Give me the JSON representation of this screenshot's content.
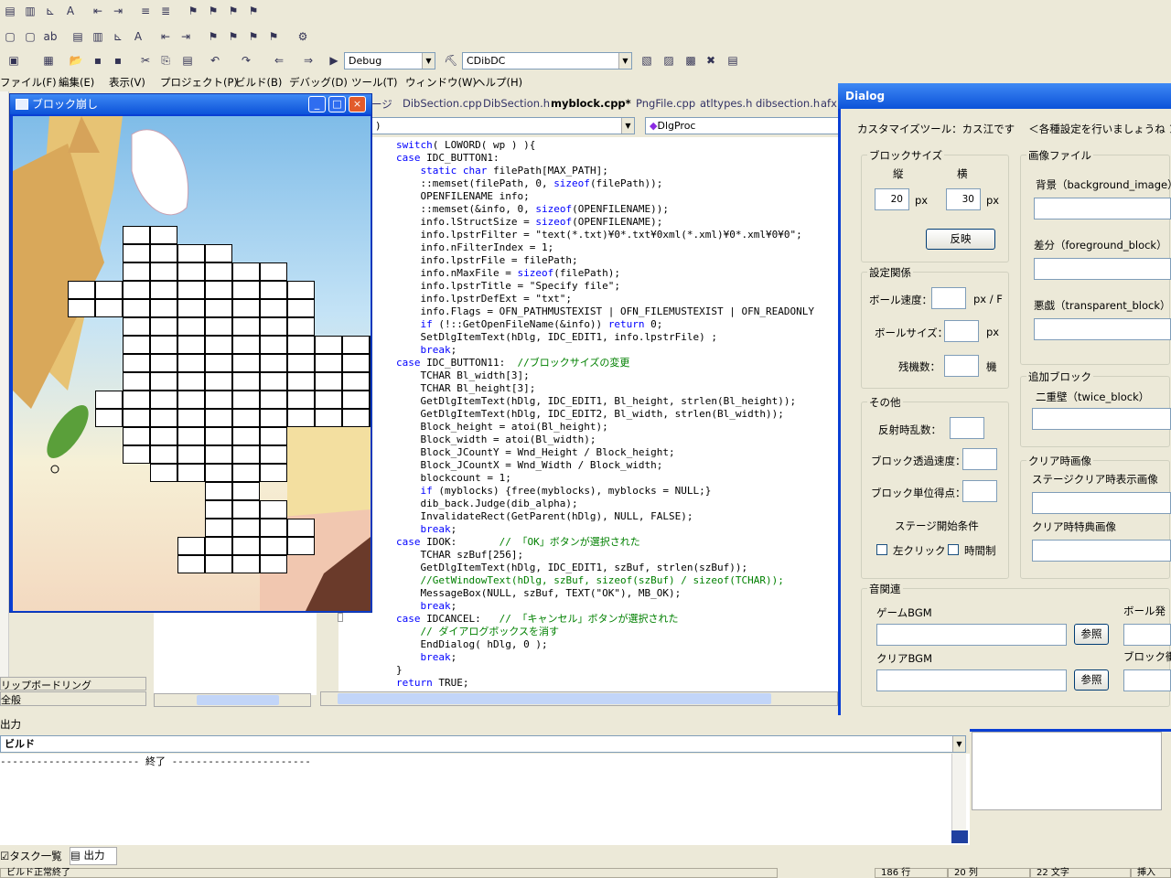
{
  "toolbar": {
    "config": "Debug",
    "class_combo": "CDibDC",
    "func_combo": "DlgProc"
  },
  "menu": [
    "ファイル(F)",
    "編集(E)",
    "表示(V)",
    "プロジェクト(P)",
    "ビルド(B)",
    "デバッグ(D)",
    "ツール(T)",
    "ウィンドウ(W)",
    "ヘルプ(H)"
  ],
  "game_window": {
    "title": "ブロック崩し",
    "minimize": "_",
    "maximize": "□",
    "close": "×"
  },
  "tabs": [
    "ージ",
    "DibSection.cpp",
    "DibSection.h",
    "myblock.cpp*",
    "PngFile.cpp",
    "atltypes.h",
    "dibsection.h",
    "afx"
  ],
  "code": [
    "switch( LOWORD( wp ) ){",
    "case IDC_BUTTON1:",
    "    static char filePath[MAX_PATH];",
    "    ::memset(filePath, 0, sizeof(filePath));",
    "    OPENFILENAME info;",
    "    ::memset(&info, 0, sizeof(OPENFILENAME));",
    "    info.lStructSize = sizeof(OPENFILENAME);",
    "    info.lpstrFilter = \"text(*.txt)¥0*.txt¥0xml(*.xml)¥0*.xml¥0¥0\";",
    "    info.nFilterIndex = 1;",
    "    info.lpstrFile = filePath;",
    "    info.nMaxFile = sizeof(filePath);",
    "    info.lpstrTitle = \"Specify file\";",
    "    info.lpstrDefExt = \"txt\";",
    "    info.Flags = OFN_PATHMUSTEXIST | OFN_FILEMUSTEXIST | OFN_READONLY",
    "    if (!::GetOpenFileName(&info)) return 0;",
    "    SetDlgItemText(hDlg, IDC_EDIT1, info.lpstrFile) ;",
    "    break;",
    "case IDC_BUTTON11:  //ブロックサイズの変更",
    "    TCHAR Bl_width[3];",
    "    TCHAR Bl_height[3];",
    "    GetDlgItemText(hDlg, IDC_EDIT1, Bl_height, strlen(Bl_height));",
    "    GetDlgItemText(hDlg, IDC_EDIT2, Bl_width, strlen(Bl_width));",
    "    Block_height = atoi(Bl_height);",
    "    Block_width = atoi(Bl_width);",
    "    Block_JCountY = Wnd_Height / Block_height;",
    "    Block_JCountX = Wnd_Width / Block_width;",
    "    blockcount = 1;",
    "    if (myblocks) {free(myblocks), myblocks = NULL;}",
    "    dib_back.Judge(dib_alpha);",
    "    InvalidateRect(GetParent(hDlg), NULL, FALSE);",
    "    break;",
    "case IDOK:       // 「OK」ボタンが選択された",
    "    TCHAR szBuf[256];",
    "    GetDlgItemText(hDlg, IDC_EDIT1, szBuf, strlen(szBuf));",
    "    //GetWindowText(hDlg, szBuf, sizeof(szBuf) / sizeof(TCHAR));",
    "    MessageBox(NULL, szBuf, TEXT(\"OK\"), MB_OK);",
    "    break;",
    "case IDCANCEL:   // 「キャンセル」ボタンが選択された",
    "    // ダイアログボックスを消す",
    "    EndDialog( hDlg, 0 );",
    "    break;",
    "}",
    "return TRUE;"
  ],
  "dialog": {
    "title": "Dialog",
    "header": "カスタマイズツール：カス江です　 ＜各種設定を行いましょうね ＞",
    "block_size": {
      "label": "ブロックサイズ",
      "v_label": "縦",
      "h_label": "横",
      "v_value": "20",
      "h_value": "30",
      "unit": "px",
      "apply": "反映"
    },
    "settings": {
      "label": "設定関係",
      "ball_speed": "ボール速度：",
      "speed_unit": "px / F",
      "ball_size": "ボールサイズ：",
      "size_unit": "px",
      "lives": "残機数：",
      "lives_unit": "機"
    },
    "other": {
      "label": "その他",
      "reflect": "反射時乱数：",
      "transparency": "ブロック透過速度：",
      "points": "ブロック単位得点：",
      "start_cond": "ステージ開始条件",
      "left_click": "左クリック",
      "time_limit": "時間制"
    },
    "image_files": {
      "label": "画像ファイル",
      "bg": "背景（background_image）",
      "fg": "差分（foreground_block）",
      "trans": "悪戯（transparent_block）"
    },
    "extra_block": {
      "label": "追加ブロック",
      "twice": "二重壁（twice_block）"
    },
    "clear_image": {
      "label": "クリア時画像",
      "stage": "ステージクリア時表示画像",
      "bonus": "クリア時特典画像"
    },
    "sound": {
      "label": "音関連",
      "game_bgm": "ゲームBGM",
      "clear_bgm": "クリアBGM",
      "browse": "参照",
      "ball_se": "ボール発",
      "block_se": "ブロック衝"
    }
  },
  "left_panel": {
    "clipboard": "リップボードリング",
    "general": "全般"
  },
  "output": {
    "header": "出力",
    "build": "ビルド",
    "line": "----------------------- 終了 -----------------------",
    "tab_tasks": "タスク一覧",
    "tab_output": "出力"
  },
  "status": {
    "msg": "ビルド正常終了",
    "line": "186 行",
    "col": "20 列",
    "chars": "22 文字",
    "mode": "挿入"
  }
}
